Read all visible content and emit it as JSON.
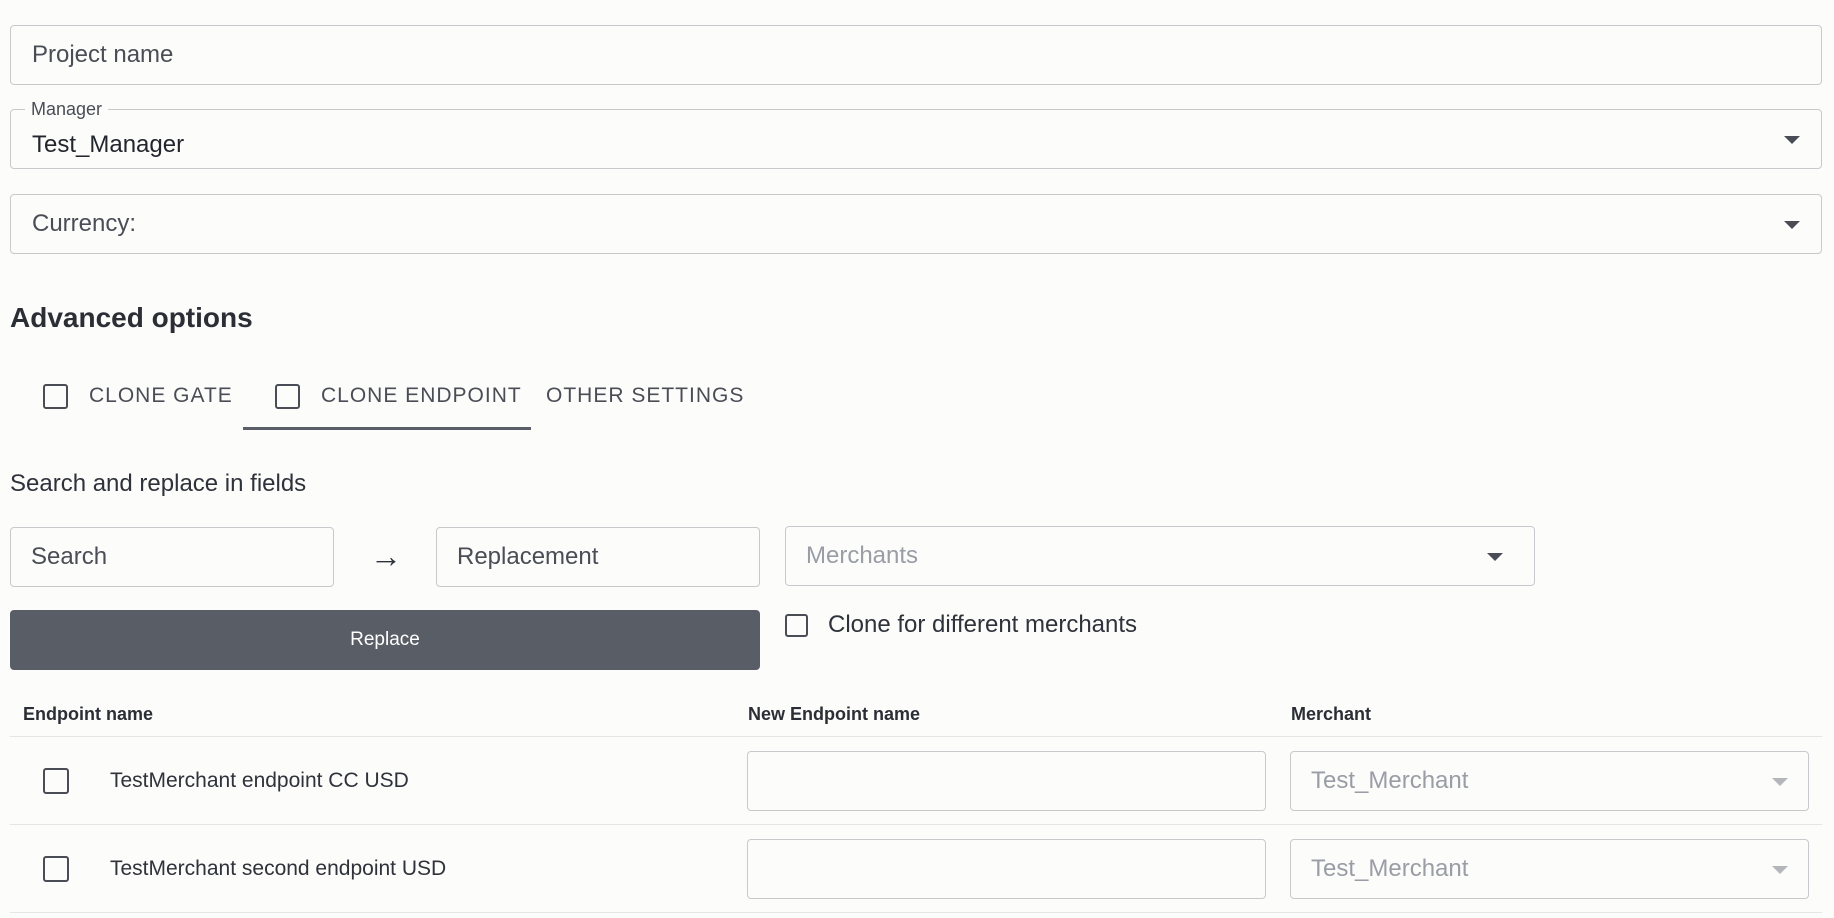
{
  "form": {
    "project_name_placeholder": "Project name",
    "manager_label": "Manager",
    "manager_value": "Test_Manager",
    "currency_placeholder": "Currency:"
  },
  "advanced": {
    "title": "Advanced options",
    "tabs": [
      {
        "label": "CLONE GATE",
        "checked": false
      },
      {
        "label": "CLONE ENDPOINT",
        "checked": false,
        "active": true
      },
      {
        "label": "OTHER SETTINGS"
      }
    ]
  },
  "search_replace": {
    "title": "Search and replace in fields",
    "search_placeholder": "Search",
    "arrow": "→",
    "replacement_placeholder": "Replacement",
    "merchants_placeholder": "Merchants",
    "replace_button": "Replace",
    "clone_checkbox_label": "Clone for different merchants"
  },
  "table": {
    "headers": [
      "Endpoint name",
      "New Endpoint name",
      "Merchant"
    ],
    "rows": [
      {
        "endpoint_name": "TestMerchant endpoint CC USD",
        "new_name": "",
        "merchant": "Test_Merchant"
      },
      {
        "endpoint_name": "TestMerchant second endpoint USD",
        "new_name": "",
        "merchant": "Test_Merchant"
      }
    ]
  },
  "colors": {
    "button_bg": "#595d66",
    "border": "#c7c9cd",
    "text": "#2f323a",
    "muted_text": "#9a9da5"
  }
}
